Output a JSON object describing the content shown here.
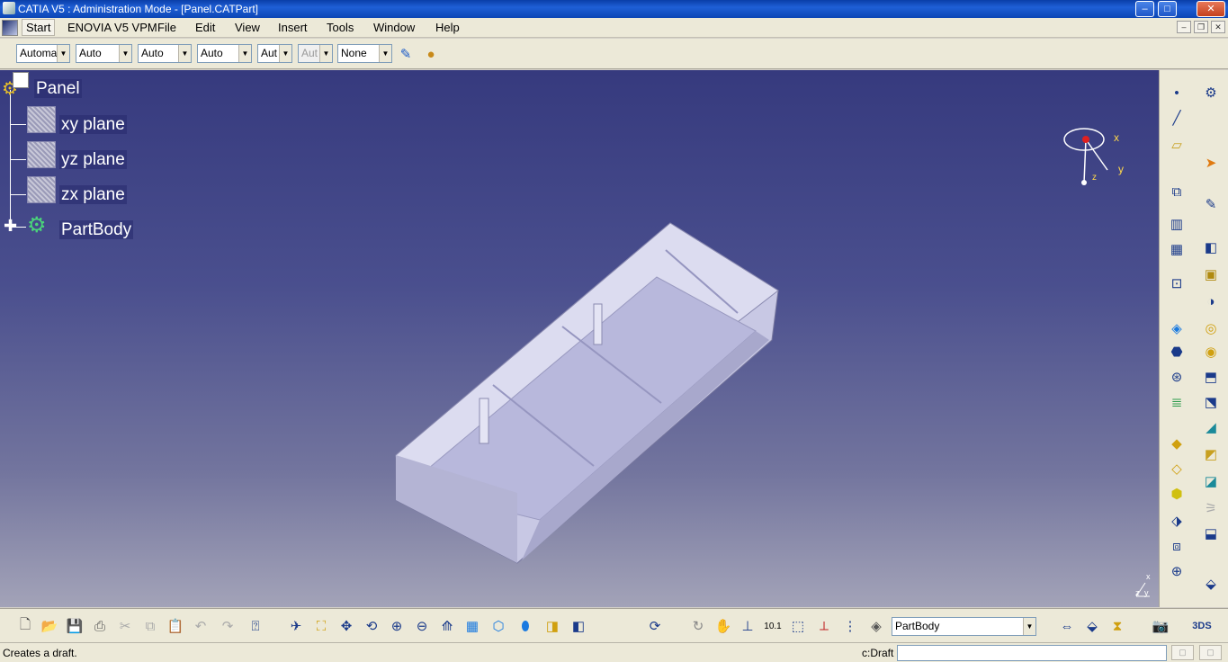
{
  "window": {
    "title": "CATIA V5 : Administration Mode - [Panel.CATPart]",
    "buttons": {
      "minimize": "–",
      "maximize": "□",
      "close": "✕"
    }
  },
  "menu": {
    "items": [
      "Start",
      "ENOVIA V5 VPM",
      "File",
      "Edit",
      "View",
      "Insert",
      "Tools",
      "Window",
      "Help"
    ],
    "mdi": {
      "minimize": "–",
      "restore": "❐",
      "close": "✕"
    }
  },
  "graphic_properties": {
    "combos": [
      "Automa",
      "Auto",
      "Auto",
      "Auto",
      "Aut",
      "Aut",
      "None"
    ]
  },
  "tree": {
    "root": "Panel",
    "items": [
      "xy plane",
      "yz plane",
      "zx plane",
      "PartBody"
    ]
  },
  "compass": {
    "x": "x",
    "y": "y",
    "z": "z"
  },
  "axis_mini": {
    "x": "x",
    "y": "y",
    "z": "z"
  },
  "workbench": {
    "current_body": "PartBody"
  },
  "status": {
    "message": "Creates a draft.",
    "command_label": "c:Draft",
    "command_value": ""
  },
  "colors": {
    "viewport_top": "#363a7e",
    "viewport_bottom": "#a3a3b8",
    "part": "#c8c8e4",
    "toolbar": "#ece9d8"
  }
}
